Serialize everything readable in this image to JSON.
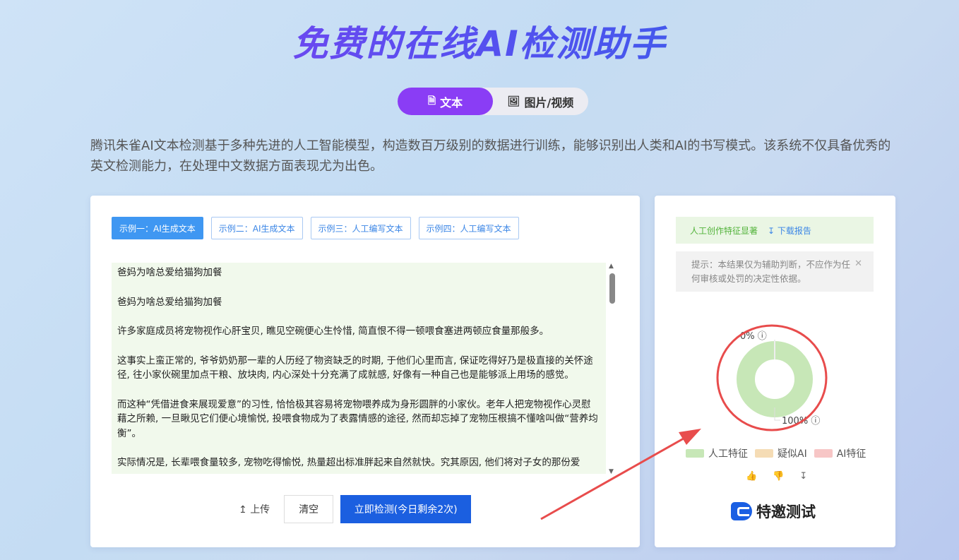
{
  "header": {
    "title": "免费的在线AI检测助手"
  },
  "mode_tabs": [
    {
      "label": "文本",
      "icon": "document-icon",
      "active": true
    },
    {
      "label": "图片/视频",
      "icon": "image-icon",
      "active": false
    }
  ],
  "description": "腾讯朱雀AI文本检测基于多种先进的人工智能模型，构造数百万级别的数据进行训练，能够识别出人类和AI的书写模式。该系统不仅具备优秀的英文检测能力，在处理中文数据方面表现尤为出色。",
  "examples": [
    {
      "label": "示例一：AI生成文本",
      "active": true
    },
    {
      "label": "示例二：AI生成文本",
      "active": false
    },
    {
      "label": "示例三：人工编写文本",
      "active": false
    },
    {
      "label": "示例四：人工编写文本",
      "active": false
    }
  ],
  "input_text": [
    "爸妈为啥总爱给猫狗加餐",
    "爸妈为啥总爱给猫狗加餐",
    "许多家庭成员将宠物视作心肝宝贝, 瞧见空碗便心生怜惜, 简直恨不得一顿喂食塞进两顿应食量那般多。",
    "这事实上蛮正常的, 爷爷奶奶那一辈的人历经了物资缺乏的时期, 于他们心里而言, 保证吃得好乃是极直接的关怀途径, 往小家伙碗里加点干粮、放块肉, 内心深处十分充满了成就感, 好像有一种自己也是能够派上用场的感觉。",
    "而这种“凭借进食来展现爱意”的习性, 恰恰极其容易将宠物喂养成为身形圆胖的小家伙。老年人把宠物视作心灵慰藉之所赖, 一旦瞅见它们便心境愉悦, 投喂食物成为了表露情感的途径, 然而却忘掉了宠物压根搞不懂啥叫做“营养均衡”。",
    "实际情况是, 长辈喂食量较多, 宠物吃得愉悦, 热量超出标准胖起来自然就快。究其原因, 他们将对子女的那份爱"
  ],
  "actions": {
    "upload_label": "上传",
    "clear_label": "清空",
    "detect_label": "立即检测(今日剩余2次)"
  },
  "result": {
    "summary": "人工创作特征显著",
    "download_label": "下载报告",
    "tip": "提示：本结果仅为辅助判断，不应作为任何审核或处罚的决定性依据。",
    "top_label": "0%",
    "bottom_label": "100%",
    "legend": [
      {
        "label": "人工特征",
        "color": "#c7e7b7"
      },
      {
        "label": "疑似AI",
        "color": "#f5dcb5"
      },
      {
        "label": "AI特征",
        "color": "#f7c6c6"
      }
    ],
    "invite_label": "特邀测试"
  },
  "chart_data": {
    "type": "pie",
    "categories": [
      "人工特征",
      "疑似AI",
      "AI特征"
    ],
    "values": [
      100,
      0,
      0
    ],
    "colors": [
      "#c7e7b7",
      "#f5dcb5",
      "#f7c6c6"
    ]
  },
  "colors": {
    "accent_purple": "#8a3df5",
    "primary_blue": "#1b5fe0",
    "annotation_red": "#e84c4c"
  }
}
